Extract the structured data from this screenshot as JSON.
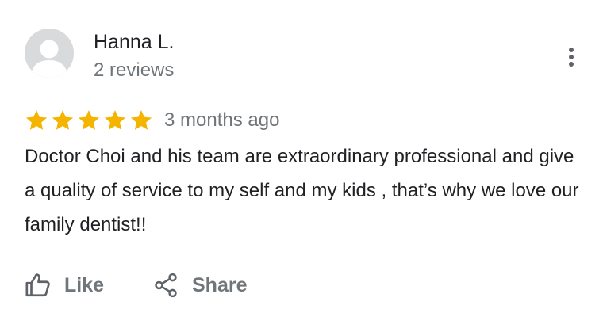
{
  "reviewer": {
    "name": "Hanna L.",
    "review_count": "2 reviews",
    "avatar_icon": "default-user-avatar-icon"
  },
  "menu": {
    "icon": "more-vertical-icon"
  },
  "review": {
    "rating": 5,
    "rating_max": 5,
    "star_color": "#f4b400",
    "date": "3 months ago",
    "text": "Doctor Choi and his team are extraordinary professional and give a quality of service to my self and my kids , that’s why we love our family dentist!!"
  },
  "actions": {
    "like": {
      "label": "Like",
      "icon": "thumbs-up-icon"
    },
    "share": {
      "label": "Share",
      "icon": "share-icon"
    }
  },
  "colors": {
    "text_primary": "#202124",
    "text_secondary": "#70757a",
    "icon_gray": "#5f6368",
    "avatar_bg": "#d9dadb"
  }
}
